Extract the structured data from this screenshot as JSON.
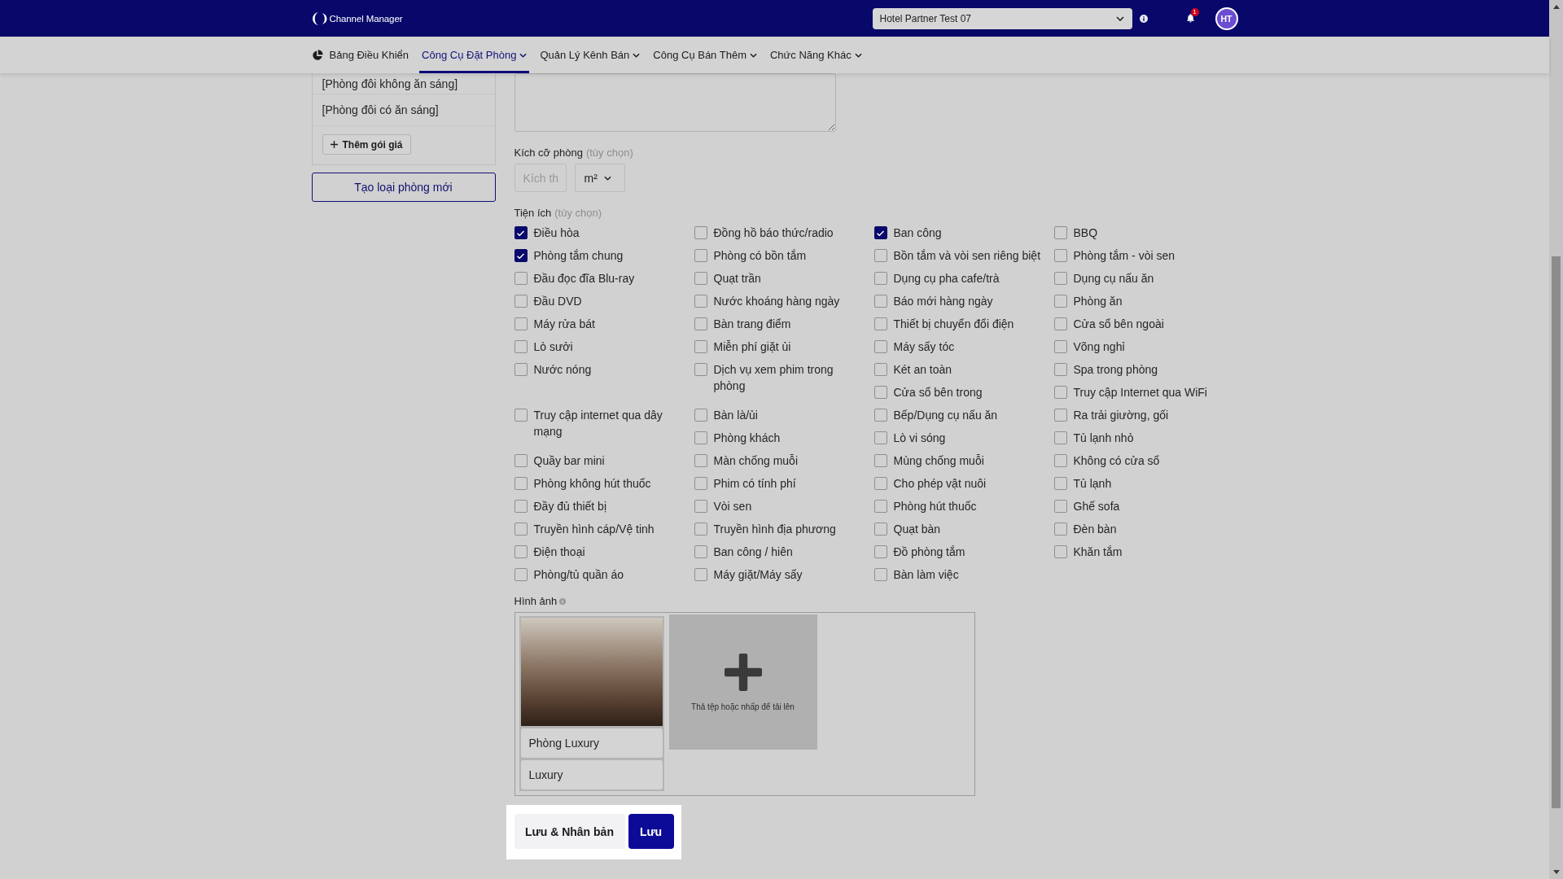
{
  "header": {
    "logo": "Channel Manager",
    "hotel_select": {
      "value": "Hotel Partner Test 07"
    },
    "notification_badge": "1",
    "avatar_initials": "HT"
  },
  "nav": [
    {
      "label": "Bảng Điều Khiển",
      "kind": "home",
      "selected": false
    },
    {
      "label": "Công Cụ Đặt Phòng",
      "kind": "menu",
      "selected": true
    },
    {
      "label": "Quản Lý Kênh Bán",
      "kind": "menu",
      "selected": false
    },
    {
      "label": "Công Cụ Bán Thêm",
      "kind": "menu",
      "selected": false
    },
    {
      "label": "Chức Năng Khác",
      "kind": "menu",
      "selected": false
    }
  ],
  "sidebar": {
    "rate_plans": [
      "[Phòng đôi không ăn sáng]",
      "[Phòng đôi có ăn sáng]"
    ],
    "add_rate_button": "Thêm gói giá",
    "create_room_type_button": "Tạo loại phòng mới"
  },
  "room_size": {
    "label": "Kích cỡ phòng",
    "hint": "(tùy chọn)",
    "placeholder": "Kích th",
    "unit": "m²"
  },
  "amenities": {
    "label": "Tiện ích",
    "hint": "(tùy chọn)",
    "items": [
      {
        "label": "Điều hòa",
        "checked": true
      },
      {
        "label": "Đồng hồ báo thức/radio",
        "checked": false
      },
      {
        "label": "Ban công",
        "checked": true
      },
      {
        "label": "BBQ",
        "checked": false
      },
      {
        "label": "Phòng tắm chung",
        "checked": true
      },
      {
        "label": "Phòng có bồn tắm",
        "checked": false
      },
      {
        "label": "Bồn tắm và vòi sen riêng biệt",
        "checked": false
      },
      {
        "label": "Phòng tắm - vòi sen",
        "checked": false
      },
      {
        "label": "Đầu đọc đĩa Blu-ray",
        "checked": false
      },
      {
        "label": "Quạt trần",
        "checked": false
      },
      {
        "label": "Dụng cụ pha cafe/trà",
        "checked": false
      },
      {
        "label": "Dụng cụ nấu ăn",
        "checked": false
      },
      {
        "label": "Đầu DVD",
        "checked": false
      },
      {
        "label": "Nước khoáng hàng ngày",
        "checked": false
      },
      {
        "label": "Báo mới hàng ngày",
        "checked": false
      },
      {
        "label": "Phòng ăn",
        "checked": false
      },
      {
        "label": "Máy rửa bát",
        "checked": false
      },
      {
        "label": "Bàn trang điểm",
        "checked": false
      },
      {
        "label": "Thiết bị chuyển đổi điện",
        "checked": false
      },
      {
        "label": "Cửa sổ bên ngoài",
        "checked": false
      },
      {
        "label": "Lò sưởi",
        "checked": false
      },
      {
        "label": "Miễn phí giặt ủi",
        "checked": false
      },
      {
        "label": "Máy sấy tóc",
        "checked": false
      },
      {
        "label": "Võng nghỉ",
        "checked": false
      },
      {
        "label": "Nước nóng",
        "checked": false
      },
      {
        "label": "Dịch vụ xem phim trong phòng",
        "checked": false
      },
      {
        "label": "Két an toàn",
        "checked": false
      },
      {
        "label": "Spa trong phòng",
        "checked": false
      },
      {
        "label": "Cửa sổ bên trong",
        "checked": false
      },
      {
        "label": "Truy cập Internet qua WiFi",
        "checked": false
      },
      {
        "label": "Truy cập internet qua dây mạng",
        "checked": false
      },
      {
        "label": "Bàn là/ủi",
        "checked": false
      },
      {
        "label": "Bếp/Dụng cụ nấu ăn",
        "checked": false
      },
      {
        "label": "Ra trải giường, gối",
        "checked": false
      },
      {
        "label": "Phòng khách",
        "checked": false
      },
      {
        "label": "Lò vi sóng",
        "checked": false
      },
      {
        "label": "Tủ lạnh nhỏ",
        "checked": false
      },
      {
        "label": "Quầy bar mini",
        "checked": false
      },
      {
        "label": "Màn chống muỗi",
        "checked": false
      },
      {
        "label": "Mùng chống muỗi",
        "checked": false
      },
      {
        "label": "Không có cửa sổ",
        "checked": false
      },
      {
        "label": "Phòng không hút thuốc",
        "checked": false
      },
      {
        "label": "Phim có tính phí",
        "checked": false
      },
      {
        "label": "Cho phép vật nuôi",
        "checked": false
      },
      {
        "label": "Tủ lạnh",
        "checked": false
      },
      {
        "label": "Đầy đủ thiết bị",
        "checked": false
      },
      {
        "label": "Vòi sen",
        "checked": false
      },
      {
        "label": "Phòng hút thuốc",
        "checked": false
      },
      {
        "label": "Ghế sofa",
        "checked": false
      },
      {
        "label": "Truyền hình cáp/Vệ tinh",
        "checked": false
      },
      {
        "label": "Truyền hình địa phương",
        "checked": false
      },
      {
        "label": "Quạt bàn",
        "checked": false
      },
      {
        "label": "Đèn bàn",
        "checked": false
      },
      {
        "label": "Điện thoại",
        "checked": false
      },
      {
        "label": "Ban công / hiên",
        "checked": false
      },
      {
        "label": "Đồ phòng tắm",
        "checked": false
      },
      {
        "label": "Khăn tắm",
        "checked": false
      },
      {
        "label": "Phòng/tủ quần áo",
        "checked": false
      },
      {
        "label": "Máy giặt/Máy sấy",
        "checked": false
      },
      {
        "label": "Bàn làm việc",
        "checked": false
      }
    ]
  },
  "images": {
    "label": "Hình ảnh",
    "photos": [
      {
        "title": "Phòng Luxury",
        "caption": "Luxury"
      }
    ],
    "upload_text": "Thả tệp hoặc nhấp để tải lên"
  },
  "actions": [
    {
      "label": "Lưu & Nhân bản",
      "kind": "secondary"
    },
    {
      "label": "Lưu",
      "kind": "primary"
    }
  ]
}
